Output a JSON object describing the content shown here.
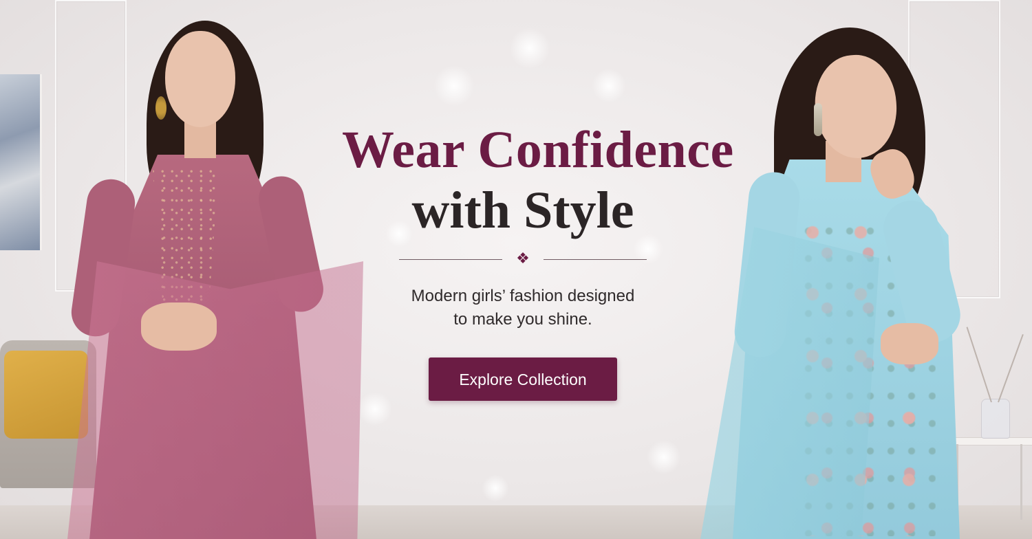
{
  "hero": {
    "headline_line1": "Wear Confidence",
    "headline_line2": "with Style",
    "ornament_icon": "fleur-ornament",
    "subtext_line1": "Modern girls’ fashion designed",
    "subtext_line2": "to make you shine.",
    "cta_label": "Explore Collection"
  },
  "colors": {
    "accent": "#6b1c44",
    "headline_dark": "#2b2526",
    "background": "#ece8e8"
  },
  "images": {
    "left_model": "woman in pink embroidered suit with dupatta",
    "right_model": "woman in light blue floral suit with dupatta"
  }
}
